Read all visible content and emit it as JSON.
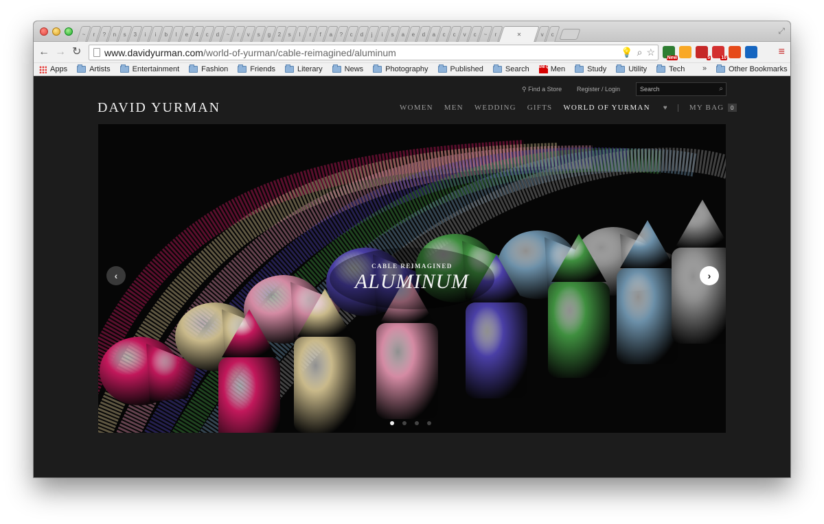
{
  "browser": {
    "tab_glyphs": [
      "~",
      "r",
      "?",
      "n",
      "s",
      "3",
      "i",
      "i",
      "b",
      "l",
      "e",
      "4",
      "c",
      "d",
      "~",
      "r",
      "v",
      "s",
      "g",
      "2",
      "s",
      "l",
      "r",
      "f",
      "a",
      "?",
      "c",
      "d",
      "j",
      "i",
      "s",
      "a",
      "e",
      "d",
      "a",
      "c",
      "c",
      "v",
      "c",
      "~",
      "r",
      "v",
      "c"
    ],
    "active_tab_close": "✕",
    "url_host": "www.davidyurman.com",
    "url_path": "/world-of-yurman/cable-reimagined/aluminum",
    "extensions": [
      {
        "name": "chrome-new-extension",
        "badge": "New",
        "color": "#2e7d32"
      },
      {
        "name": "google-drive-extension",
        "badge": "",
        "color": "#f9a825"
      },
      {
        "name": "adblock-extension",
        "badge": "5",
        "color": "#c62828"
      },
      {
        "name": "flipboard-extension",
        "badge": "10",
        "color": "#d32f2f"
      },
      {
        "name": "stumbleupon-extension",
        "badge": "",
        "color": "#e64a19"
      },
      {
        "name": "metrics-extension",
        "badge": "",
        "color": "#1565c0"
      }
    ],
    "bookmarks": [
      "Artists",
      "Entertainment",
      "Fashion",
      "Friends",
      "Literary",
      "News",
      "Photography",
      "Published",
      "Search",
      "Men",
      "Study",
      "Utility",
      "Tech"
    ],
    "apps_label": "Apps",
    "uniqlo_text": "UNI QLO",
    "overflow_chevron": "»",
    "other_bookmarks": "Other Bookmarks"
  },
  "site": {
    "find_store": "Find a Store",
    "register_login": "Register / Login",
    "search_placeholder": "Search",
    "logo": "DAVID YURMAN",
    "nav": [
      "WOMEN",
      "MEN",
      "WEDDING",
      "GIFTS",
      "WORLD OF YURMAN"
    ],
    "active_nav": "WORLD OF YURMAN",
    "bag_label": "MY BAG",
    "bag_count": "0",
    "hero": {
      "eyebrow": "CABLE REIMAGINED",
      "headline": "ALUMINUM",
      "slide_count": 4,
      "active_slide": 1
    },
    "colors": {
      "background": "#1c1c1c",
      "bracelet_colors": [
        "#c2185b",
        "#c9b98a",
        "#d48aa3",
        "#4a3fa6",
        "#3f8f3f",
        "#6b8fa8",
        "#8a8a8a"
      ]
    }
  }
}
